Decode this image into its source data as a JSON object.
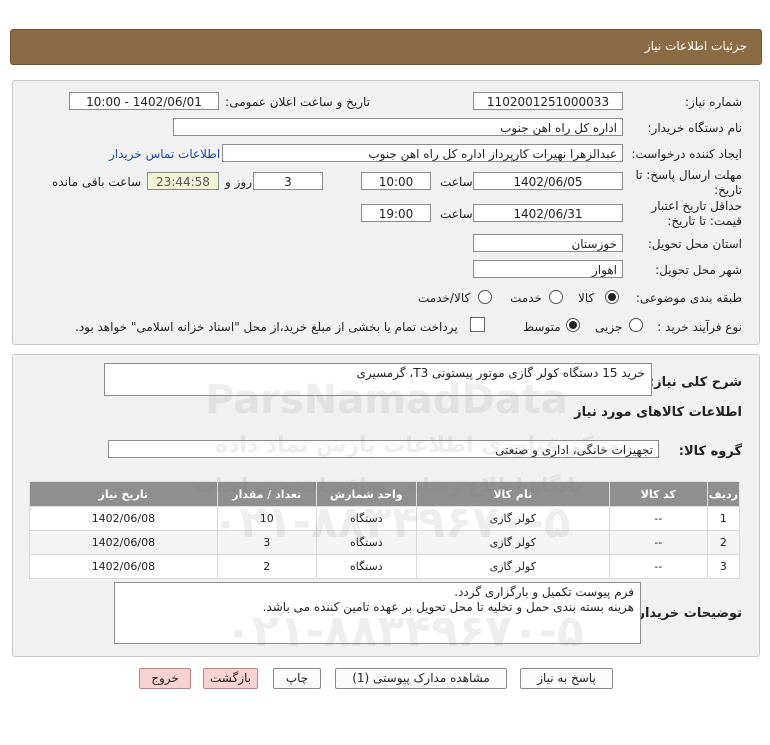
{
  "header": {
    "title": "جزئیات اطلاعات نیاز"
  },
  "form": {
    "need_number_label": "شماره نیاز:",
    "need_number": "1102001251000033",
    "announce_label": "تاریخ و ساعت اعلان عمومی:",
    "announce_value": "1402/06/01 - 10:00",
    "buyer_org_label": "نام دستگاه خریدار:",
    "buyer_org": "اداره کل راه اهن جنوب",
    "creator_label": "ایجاد کننده درخواست:",
    "creator": "عبدالزهرا نهیرات کارپرداز اداره کل راه اهن جنوب",
    "contact_link": "اطلاعات تماس خریدار",
    "deadline_label_1": "مهلت ارسال پاسخ: تا",
    "deadline_label_2": "تاریخ:",
    "deadline_date": "1402/06/05",
    "hour_label": "ساعت",
    "deadline_time": "10:00",
    "days_value": "3",
    "days_label": "روز و",
    "remaining_time": "23:44:58",
    "remaining_label": "ساعت باقی مانده",
    "validity_label_1": "حداقل تاریخ اعتبار",
    "validity_label_2": "قیمت: تا تاریخ:",
    "validity_date": "1402/06/31",
    "validity_time": "19:00",
    "province_label": "استان محل تحویل:",
    "province": "خوزستان",
    "city_label": "شهر محل تحویل:",
    "city": "اهواز",
    "category_label": "طبقه بندی موضوعی:",
    "category_options": [
      "کالا",
      "خدمت",
      "کالا/خدمت"
    ],
    "purchase_type_label": "نوع فرآیند خرید :",
    "purchase_options": [
      "جزیی",
      "متوسط"
    ],
    "payment_note": "پرداخت تمام یا بخشی از مبلغ خرید،از محل \"اسناد خزانه اسلامی\" خواهد بود."
  },
  "summary": {
    "desc_label": "شرح کلی نیاز:",
    "desc_value": "خرید 15 دستگاه کولر گازی موتور پیستونی T3، گرمسیری",
    "goods_info_title": "اطلاعات کالاهای مورد نیاز",
    "goods_group_label": "گروه کالا:",
    "goods_group_value": "تجهیزات خانگی، اداری و صنعتی"
  },
  "table": {
    "headers": [
      "ردیف",
      "کد کالا",
      "نام کالا",
      "واحد شمارش",
      "تعداد / مقدار",
      "تاریخ نیاز"
    ],
    "rows": [
      [
        "1",
        "--",
        "کولر گازی",
        "دستگاه",
        "10",
        "1402/06/08"
      ],
      [
        "2",
        "--",
        "کولر گازی",
        "دستگاه",
        "3",
        "1402/06/08"
      ],
      [
        "3",
        "--",
        "کولر گازی",
        "دستگاه",
        "2",
        "1402/06/08"
      ]
    ]
  },
  "buyer_notes": {
    "label": "توضیحات خریدار:",
    "line1": "فرم پیوست تکمیل و بارگزاری گردد.",
    "line2": "هزینه بسته بندی حمل و تخلیه تا محل تحویل بر عهده تامین کننده می باشد."
  },
  "buttons": {
    "reply": "پاسخ به نیاز",
    "attachments": "مشاهده مدارک پیوستی (1)",
    "print": "چاپ",
    "back": "بازگشت",
    "exit": "خروج"
  },
  "watermark": {
    "brand": "ParsNamadData",
    "tagline": "مرکز فناوری اطلاعات پارس نماد داده",
    "site": "پایگاه اطلاع رسانی مناقصات و مزایدات",
    "phone": "۰۲۱-۸۸۳۴۹۶۷۰-۵"
  },
  "colors": {
    "header": "#8a6b44",
    "table_header": "#8f8f8f",
    "link": "#1a4aa8"
  }
}
